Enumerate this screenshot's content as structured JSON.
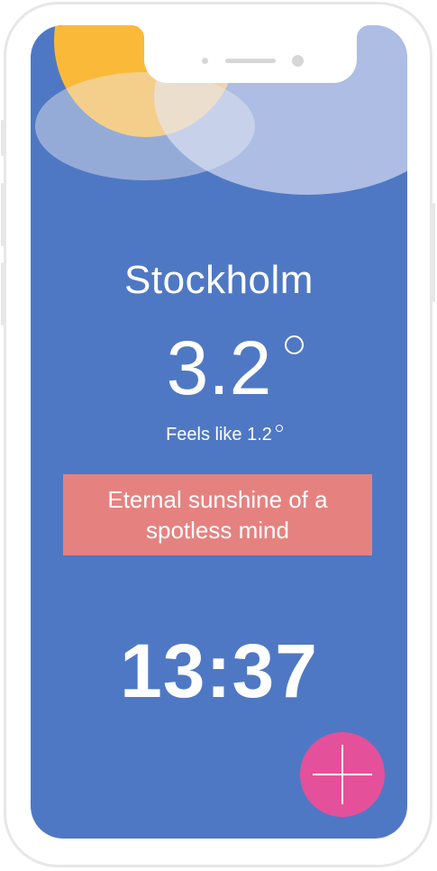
{
  "weather": {
    "city": "Stockholm",
    "temperature": "3.2",
    "feels_like_label": "Feels like 1.2",
    "condition_icon": "sun-behind-clouds-icon"
  },
  "quote": {
    "text": "Eternal sunshine of a spotless mind"
  },
  "clock": {
    "time": "13:37"
  },
  "fab": {
    "icon": "plus-icon"
  },
  "colors": {
    "background": "#4f78c4",
    "sun": "#fbb93a",
    "quote_box": "#e58280",
    "fab": "#e5509a"
  }
}
